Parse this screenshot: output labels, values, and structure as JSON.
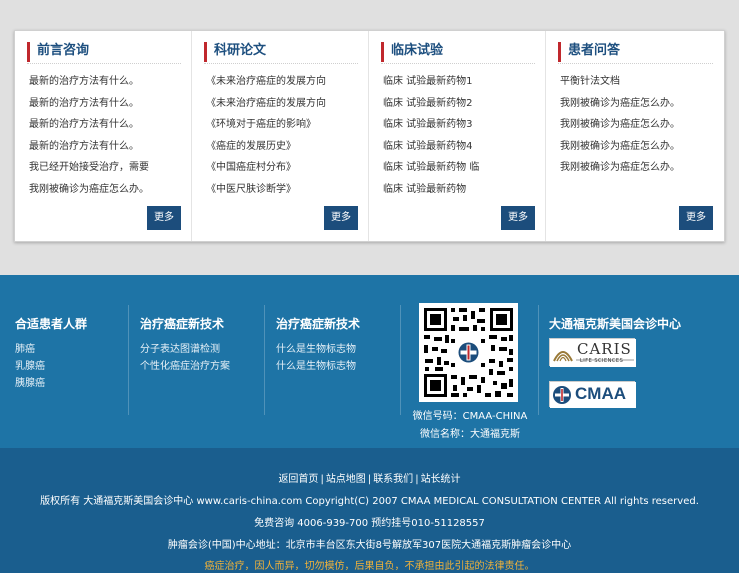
{
  "cards": [
    {
      "title": "前言咨询",
      "items": [
        "最新的治疗方法有什么。",
        "最新的治疗方法有什么。",
        "最新的治疗方法有什么。",
        "最新的治疗方法有什么。",
        "我已经开始接受治疗，需要",
        "我刚被确诊为癌症怎么办。"
      ],
      "more": "更多"
    },
    {
      "title": "科研论文",
      "items": [
        "《未来治疗癌症的发展方向",
        "《未来治疗癌症的发展方向",
        "《环境对于癌症的影响》",
        "《癌症的发展历史》",
        "《中国癌症村分布》",
        "《中医尺肤诊断学》"
      ],
      "more": "更多"
    },
    {
      "title": "临床试验",
      "items": [
        "临床 试验最新药物1",
        "临床 试验最新药物2",
        "临床 试验最新药物3",
        "临床 试验最新药物4",
        "临床 试验最新药物 临",
        "临床 试验最新药物"
      ],
      "more": "更多"
    },
    {
      "title": "患者问答",
      "items": [
        "平衡针法文档",
        "我刚被确诊为癌症怎么办。",
        "我刚被确诊为癌症怎么办。",
        "我刚被确诊为癌症怎么办。",
        "我刚被确诊为癌症怎么办。"
      ],
      "more": "更多"
    }
  ],
  "footer": {
    "columns": [
      {
        "title": "合适患者人群",
        "items": [
          "肺癌",
          "乳腺癌",
          "胰腺癌"
        ]
      },
      {
        "title": "治疗癌症新技术",
        "items": [
          "分子表达图谱检测",
          "个性化癌症治疗方案"
        ]
      },
      {
        "title": "治疗癌症新技术",
        "items": [
          "什么是生物标志物",
          "什么是生物标志物"
        ]
      }
    ],
    "wechat": {
      "id_line": "微信号码：CMAA-CHINA",
      "name_line": "微信名称：大通福克斯"
    },
    "center": {
      "title": "大通福克斯美国会诊中心",
      "caris_name": "CARIS",
      "caris_sub": "LIFE SCIENCES",
      "cmaa_name": "CMAA"
    }
  },
  "bottom": {
    "links": [
      "返回首页",
      "站点地图",
      "联系我们",
      "站长统计"
    ],
    "separator": "|",
    "copyright": "版权所有 大通福克斯美国会诊中心 www.caris-china.com Copyright(C) 2007 CMAA MEDICAL CONSULTATION CENTER All rights reserved.",
    "phone": "免费咨询 4006-939-700 预约挂号010-51128557",
    "address": "肿瘤会诊(中国)中心地址：北京市丰台区东大街8号解放军307医院大通福克斯肿瘤会诊中心",
    "warning": "癌症治疗，因人而异，切勿模仿，后果自负，不承担由此引起的法律责任。"
  },
  "colors": {
    "accent_red": "#c0282d",
    "brand_blue": "#1c4d7c",
    "footer_blue": "#1e74a6",
    "footer_dark": "#1a5e8e",
    "warning_orange": "#f0b23a"
  }
}
